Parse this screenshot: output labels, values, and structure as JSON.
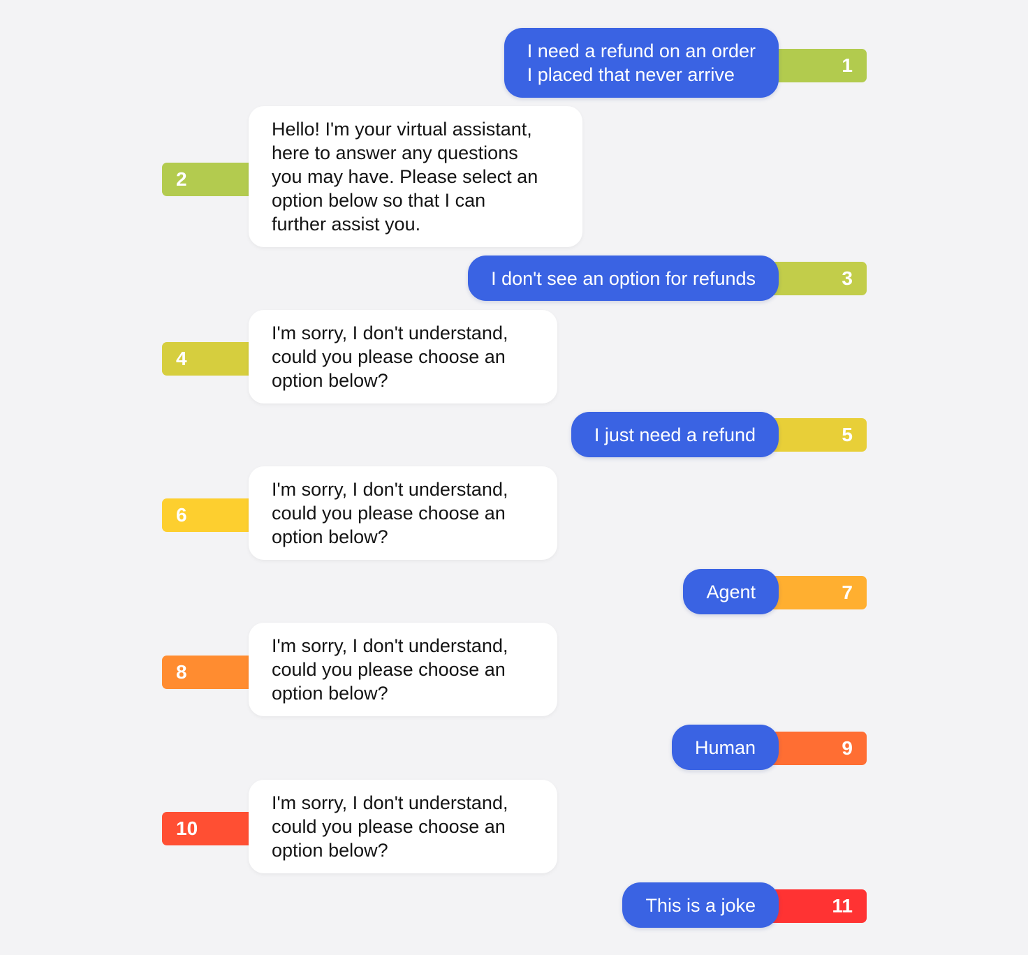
{
  "conversation": {
    "messages": [
      {
        "index": "1",
        "sender": "user",
        "text": "I need a refund on an order\nI placed that never arrive",
        "tag_color": "#b2cb4e"
      },
      {
        "index": "2",
        "sender": "bot",
        "text": "Hello! I'm your virtual assistant,\nhere to answer any questions\nyou may have. Please select an\noption below so that I can\nfurther assist you.",
        "tag_color": "#b3cb4f"
      },
      {
        "index": "3",
        "sender": "user",
        "text": "I don't see an option for refunds",
        "tag_color": "#c2cd4a"
      },
      {
        "index": "4",
        "sender": "bot",
        "text": "I'm sorry, I don't understand,\ncould you please choose an\noption below?",
        "tag_color": "#d6ce3e"
      },
      {
        "index": "5",
        "sender": "user",
        "text": "I just need a refund",
        "tag_color": "#e8cf38"
      },
      {
        "index": "6",
        "sender": "bot",
        "text": "I'm sorry, I don't understand,\ncould you please choose an\noption below?",
        "tag_color": "#fdcf2f"
      },
      {
        "index": "7",
        "sender": "user",
        "text": "Agent",
        "tag_color": "#ffaf30"
      },
      {
        "index": "8",
        "sender": "bot",
        "text": "I'm sorry, I don't understand,\ncould you please choose an\noption below?",
        "tag_color": "#ff8c30"
      },
      {
        "index": "9",
        "sender": "user",
        "text": "Human",
        "tag_color": "#ff6e33"
      },
      {
        "index": "10",
        "sender": "bot",
        "text": "I'm sorry, I don't understand,\ncould you please choose an\noption below?",
        "tag_color": "#ff4f33"
      },
      {
        "index": "11",
        "sender": "user",
        "text": "This is a joke",
        "tag_color": "#ff3333"
      }
    ]
  },
  "colors": {
    "background": "#f3f3f5",
    "user_bubble": "#3a63e3",
    "bot_bubble": "#ffffff",
    "bot_text": "#141414"
  }
}
